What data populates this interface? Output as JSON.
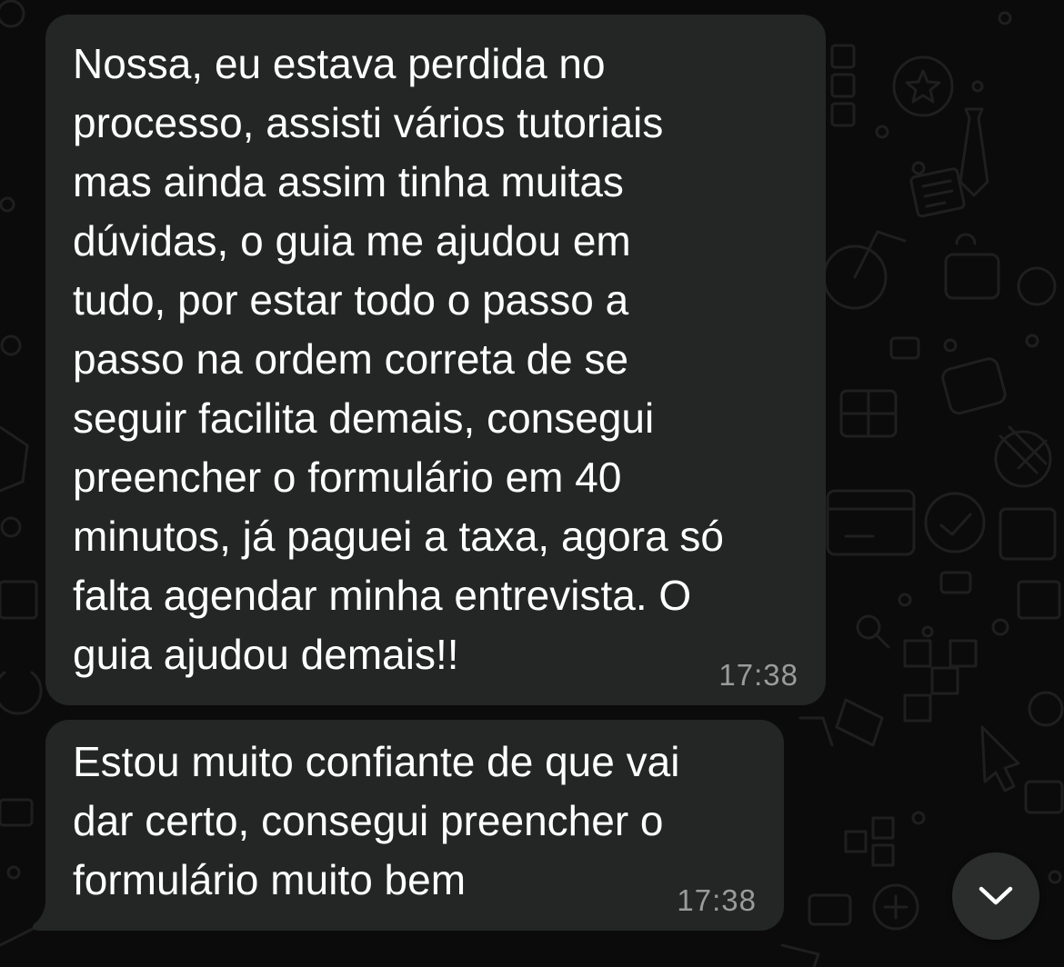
{
  "messages": [
    {
      "text": "Nossa, eu estava perdida no\nprocesso, assisti vários tutoriais\nmas ainda assim tinha muitas\ndúvidas, o guia me ajudou em\ntudo, por estar todo o passo a\npasso na ordem correta de se\nseguir facilita demais, consegui\npreencher o formulário em 40\nminutos, já paguei a taxa, agora só\nfalta agendar minha entrevista. O\nguia ajudou demais!!",
      "time": "17:38"
    },
    {
      "text": "Estou muito confiante de que vai\ndar certo, consegui preencher o\nformulário muito bem",
      "time": "17:38"
    }
  ],
  "icons": {
    "scroll_down": "chevron-down-icon",
    "background": "chat-wallpaper-doodles"
  },
  "colors": {
    "background": "#0b0b0b",
    "bubble": "#242626",
    "text": "#ffffff",
    "timestamp": "#9a9c9c",
    "scroll_button": "#2b2d2d"
  }
}
